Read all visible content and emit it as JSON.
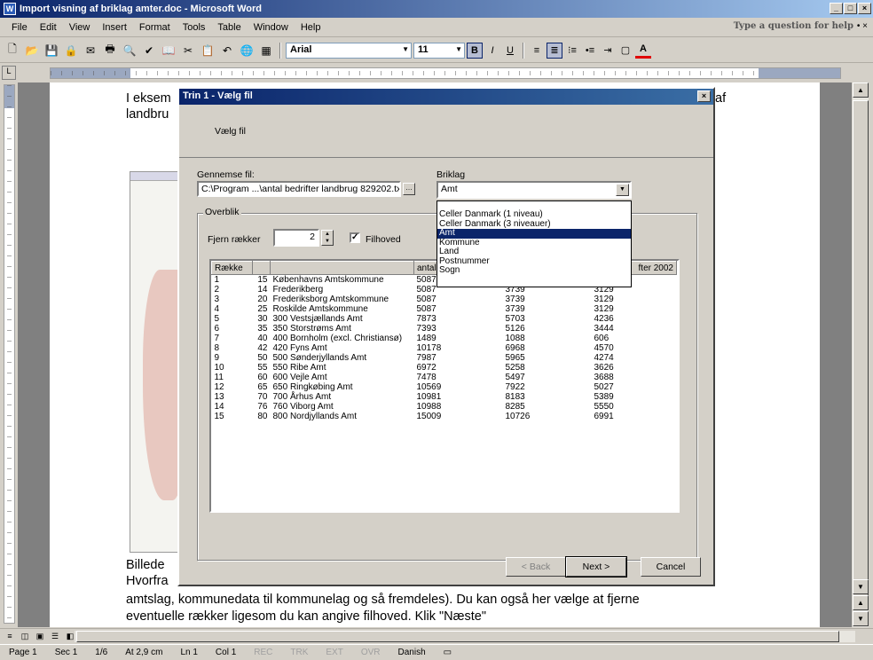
{
  "window": {
    "title": "Import visning af briklag amter.doc - Microsoft Word",
    "buttons": [
      "_",
      "□",
      "×"
    ]
  },
  "menu": {
    "items": [
      "File",
      "Edit",
      "View",
      "Insert",
      "Format",
      "Tools",
      "Table",
      "Window",
      "Help"
    ],
    "help_placeholder": "Type a question for help",
    "close_doc": "• ×"
  },
  "toolbar": {
    "font": "Arial",
    "size": "11",
    "bold": "B",
    "italic": "I",
    "underline": "U",
    "font_color": "A"
  },
  "document": {
    "line1_start": "I eksem",
    "line1_end": "af",
    "line2_start": "landbru",
    "caption_start": "Billede",
    "line_hvorfra": "Hvorfra",
    "line_amtslag": "amtslag, kommunedata til kommunelag og så fremdeles). Du kan også her vælge at fjerne",
    "line_eventuelle": "eventuelle rækker ligesom du kan angive filhoved. Klik \"Næste\""
  },
  "statusbar": {
    "page": "Page 1",
    "sec": "Sec 1",
    "pages": "1/6",
    "at": "At 2,9 cm",
    "ln": "Ln 1",
    "col": "Col 1",
    "rec": "REC",
    "trk": "TRK",
    "ext": "EXT",
    "ovr": "OVR",
    "lang": "Danish"
  },
  "dialog": {
    "title": "Trin 1 - Vælg fil",
    "step": "Vælg fil",
    "browse_label": "Gennemse fil:",
    "file_path": "C:\\Program ...\\antal bedrifter landbrug 829202.txt",
    "briklag_label": "Briklag",
    "briklag_value": "Amt",
    "overview_label": "Overblik",
    "remove_rows_label": "Fjern rækker",
    "remove_rows_value": "2",
    "header_checkbox_label": "Filhoved",
    "header_checked": "✓",
    "back_button": "< Back",
    "next_button": "Next >",
    "cancel_button": "Cancel"
  },
  "briklag_options": [
    "Celler Danmark (1 niveau)",
    "Celler Danmark (3 niveauer)",
    "Amt",
    "Kommune",
    "Land",
    "Postnummer",
    "Sogn"
  ],
  "grid": {
    "headers": [
      "Række",
      "",
      "",
      "antal",
      "",
      "fter 2002"
    ],
    "rows": [
      [
        "1",
        "15",
        "Københavns Amtskommune",
        "5087",
        "",
        ""
      ],
      [
        "2",
        "14",
        "Frederikberg",
        "5087",
        "3739",
        "3129"
      ],
      [
        "3",
        "20",
        "Frederiksborg Amtskommune",
        "5087",
        "3739",
        "3129"
      ],
      [
        "4",
        "25",
        "Roskilde Amtskommune",
        "5087",
        "3739",
        "3129"
      ],
      [
        "5",
        "30",
        "300 Vestsjællands Amt",
        "7873",
        "5703",
        "4236"
      ],
      [
        "6",
        "35",
        "350 Storstrøms Amt",
        "7393",
        "5126",
        "3444"
      ],
      [
        "7",
        "40",
        "400 Bornholm (excl. Christiansø)",
        "1489",
        "1088",
        "606"
      ],
      [
        "8",
        "42",
        "420 Fyns Amt",
        "10178",
        "6968",
        "4570"
      ],
      [
        "9",
        "50",
        "500 Sønderjyllands Amt",
        "7987",
        "5965",
        "4274"
      ],
      [
        "10",
        "55",
        "550 Ribe Amt",
        "6972",
        "5258",
        "3626"
      ],
      [
        "11",
        "60",
        "600 Vejle Amt",
        "7478",
        "5497",
        "3688"
      ],
      [
        "12",
        "65",
        "650 Ringkøbing Amt",
        "10569",
        "7922",
        "5027"
      ],
      [
        "13",
        "70",
        "700 Århus Amt",
        "10981",
        "8183",
        "5389"
      ],
      [
        "14",
        "76",
        "760 Viborg Amt",
        "10988",
        "8285",
        "5550"
      ],
      [
        "15",
        "80",
        "800 Nordjyllands Amt",
        "15009",
        "10726",
        "6991"
      ]
    ]
  }
}
